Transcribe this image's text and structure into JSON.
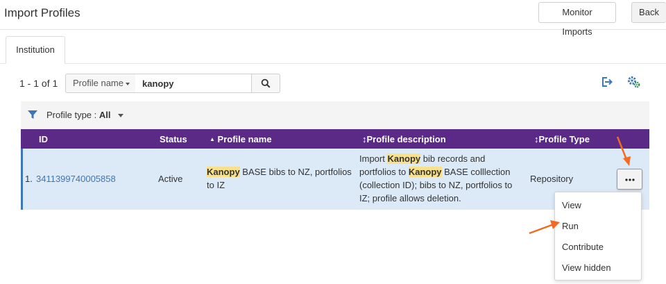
{
  "header": {
    "title": "Import Profiles",
    "monitor_label": "Monitor Imports",
    "back_label": "Back"
  },
  "tabs": [
    {
      "label": "Institution",
      "active": true
    }
  ],
  "toolbar": {
    "pager_text": "1 - 1 of 1",
    "filter_field": "Profile name",
    "search_value": "kanopy",
    "icons": [
      "search-icon",
      "export-icon",
      "settings-icon"
    ]
  },
  "facet": {
    "label": "Profile type : ",
    "value": "All"
  },
  "table": {
    "columns": {
      "id": "ID",
      "status": "Status",
      "name": "Profile name",
      "description": "Profile description",
      "type": "Profile Type"
    },
    "rows": [
      {
        "index": "1.",
        "id": "3411399740005858",
        "status": "Active",
        "name": {
          "hl": "Kanopy",
          "rest": " BASE bibs to NZ, portfolios to IZ"
        },
        "description": {
          "p1": "Import ",
          "hl1": "Kanopy",
          "p2": " bib records and portfolios to ",
          "hl2": "Kanopy",
          "p3": " BASE colllection (collection ID); bibs to NZ, portfolios to IZ; profile allows deletion."
        },
        "type": "Repository"
      }
    ]
  },
  "row_actions_menu": {
    "items": [
      "View",
      "Run",
      "Contribute",
      "View hidden"
    ]
  },
  "colors": {
    "header_purple": "#5b2a86",
    "row_selected": "#dce9f7",
    "highlight": "#f9e08a",
    "link": "#3e77b5",
    "annotation_arrow": "#f26b21"
  }
}
